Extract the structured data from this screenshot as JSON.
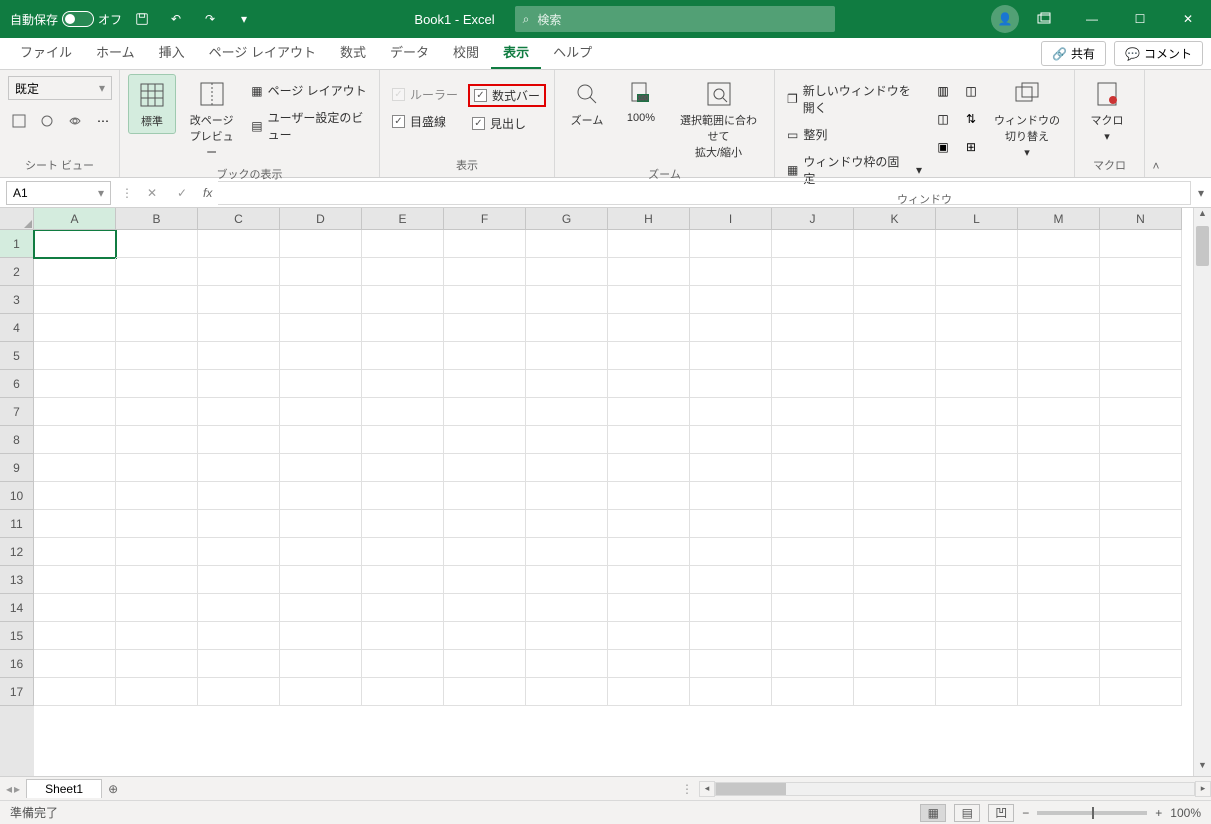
{
  "titlebar": {
    "autosave_label": "自動保存",
    "autosave_state": "オフ",
    "book_name": "Book1 - Excel",
    "search_placeholder": "検索"
  },
  "tabs": {
    "file": "ファイル",
    "home": "ホーム",
    "insert": "挿入",
    "page_layout": "ページ レイアウト",
    "formulas": "数式",
    "data": "データ",
    "review": "校閲",
    "view": "表示",
    "help": "ヘルプ",
    "share": "共有",
    "comment": "コメント"
  },
  "ribbon": {
    "sheet_view_dropdown": "既定",
    "sheet_view_group": "シート ビュー",
    "normal": "標準",
    "page_break": "改ページ\nプレビュー",
    "page_layout_btn": "ページ レイアウト",
    "custom_views": "ユーザー設定のビュー",
    "book_view_group": "ブックの表示",
    "ruler": "ルーラー",
    "formula_bar_cb": "数式バー",
    "gridlines": "目盛線",
    "headings": "見出し",
    "show_group": "表示",
    "zoom": "ズーム",
    "hundred": "100%",
    "zoom_selection": "選択範囲に合わせて\n拡大/縮小",
    "zoom_group": "ズーム",
    "new_window": "新しいウィンドウを開く",
    "arrange": "整列",
    "freeze": "ウィンドウ枠の固定",
    "switch_window": "ウィンドウの\n切り替え",
    "window_group": "ウィンドウ",
    "macros": "マクロ",
    "macros_group": "マクロ"
  },
  "namebox": {
    "value": "A1"
  },
  "columns": [
    "A",
    "B",
    "C",
    "D",
    "E",
    "F",
    "G",
    "H",
    "I",
    "J",
    "K",
    "L",
    "M",
    "N"
  ],
  "rows": [
    "1",
    "2",
    "3",
    "4",
    "5",
    "6",
    "7",
    "8",
    "9",
    "10",
    "11",
    "12",
    "13",
    "14",
    "15",
    "16",
    "17"
  ],
  "sheet_tabs": {
    "sheet1": "Sheet1"
  },
  "status": {
    "ready": "準備完了",
    "zoom": "100%"
  }
}
